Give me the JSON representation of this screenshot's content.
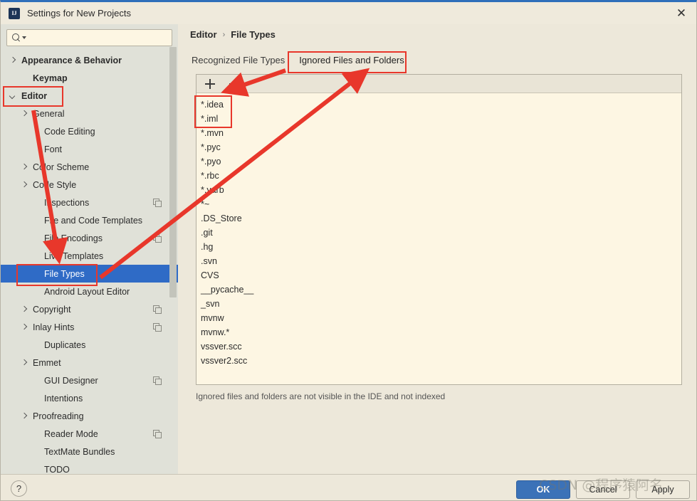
{
  "window": {
    "title": "Settings for New Projects",
    "app_icon": "intellij-idea-icon",
    "close_icon": "✕"
  },
  "sidebar": {
    "search": {
      "placeholder": "",
      "value": "",
      "icon": "search-icon"
    },
    "items": [
      {
        "label": "Appearance & Behavior",
        "indent": 0,
        "chevron": "right",
        "bold": true,
        "selected": false,
        "copy": false
      },
      {
        "label": "Keymap",
        "indent": 1,
        "chevron": "none",
        "bold": true,
        "selected": false,
        "copy": false
      },
      {
        "label": "Editor",
        "indent": 0,
        "chevron": "down",
        "bold": true,
        "selected": false,
        "copy": false
      },
      {
        "label": "General",
        "indent": 1,
        "chevron": "right",
        "bold": false,
        "selected": false,
        "copy": false
      },
      {
        "label": "Code Editing",
        "indent": 2,
        "chevron": "none",
        "bold": false,
        "selected": false,
        "copy": false
      },
      {
        "label": "Font",
        "indent": 2,
        "chevron": "none",
        "bold": false,
        "selected": false,
        "copy": false
      },
      {
        "label": "Color Scheme",
        "indent": 1,
        "chevron": "right",
        "bold": false,
        "selected": false,
        "copy": false
      },
      {
        "label": "Code Style",
        "indent": 1,
        "chevron": "right",
        "bold": false,
        "selected": false,
        "copy": false
      },
      {
        "label": "Inspections",
        "indent": 2,
        "chevron": "none",
        "bold": false,
        "selected": false,
        "copy": true
      },
      {
        "label": "File and Code Templates",
        "indent": 2,
        "chevron": "none",
        "bold": false,
        "selected": false,
        "copy": false
      },
      {
        "label": "File Encodings",
        "indent": 2,
        "chevron": "none",
        "bold": false,
        "selected": false,
        "copy": true
      },
      {
        "label": "Live Templates",
        "indent": 2,
        "chevron": "none",
        "bold": false,
        "selected": false,
        "copy": false
      },
      {
        "label": "File Types",
        "indent": 2,
        "chevron": "none",
        "bold": false,
        "selected": true,
        "copy": false
      },
      {
        "label": "Android Layout Editor",
        "indent": 2,
        "chevron": "none",
        "bold": false,
        "selected": false,
        "copy": false
      },
      {
        "label": "Copyright",
        "indent": 1,
        "chevron": "right",
        "bold": false,
        "selected": false,
        "copy": true
      },
      {
        "label": "Inlay Hints",
        "indent": 1,
        "chevron": "right",
        "bold": false,
        "selected": false,
        "copy": true
      },
      {
        "label": "Duplicates",
        "indent": 2,
        "chevron": "none",
        "bold": false,
        "selected": false,
        "copy": false
      },
      {
        "label": "Emmet",
        "indent": 1,
        "chevron": "right",
        "bold": false,
        "selected": false,
        "copy": false
      },
      {
        "label": "GUI Designer",
        "indent": 2,
        "chevron": "none",
        "bold": false,
        "selected": false,
        "copy": true
      },
      {
        "label": "Intentions",
        "indent": 2,
        "chevron": "none",
        "bold": false,
        "selected": false,
        "copy": false
      },
      {
        "label": "Proofreading",
        "indent": 1,
        "chevron": "right",
        "bold": false,
        "selected": false,
        "copy": false
      },
      {
        "label": "Reader Mode",
        "indent": 2,
        "chevron": "none",
        "bold": false,
        "selected": false,
        "copy": true
      },
      {
        "label": "TextMate Bundles",
        "indent": 2,
        "chevron": "none",
        "bold": false,
        "selected": false,
        "copy": false
      },
      {
        "label": "TODO",
        "indent": 2,
        "chevron": "none",
        "bold": false,
        "selected": false,
        "copy": false
      }
    ]
  },
  "main": {
    "breadcrumb": {
      "root": "Editor",
      "separator": "›",
      "leaf": "File Types"
    },
    "tabs": [
      {
        "label": "Recognized File Types",
        "active": false
      },
      {
        "label": "Ignored Files and Folders",
        "active": true
      }
    ],
    "toolbar": {
      "add_icon": "plus-icon",
      "remove_icon": "minus-icon"
    },
    "ignored_items": [
      "*.idea",
      "*.iml",
      "*.mvn",
      "*.pyc",
      "*.pyo",
      "*.rbc",
      "*.yarb",
      "*~",
      ".DS_Store",
      ".git",
      ".hg",
      ".svn",
      "CVS",
      "__pycache__",
      "_svn",
      "mvnw",
      "mvnw.*",
      "vssver.scc",
      "vssver2.scc"
    ],
    "hint": "Ignored files and folders are not visible in the IDE and not indexed"
  },
  "footer": {
    "help_label": "?",
    "ok_label": "OK",
    "cancel_label": "Cancel",
    "apply_label": "Apply"
  },
  "watermark": {
    "text": "CSDN @程序猿阿名"
  },
  "colors": {
    "accent_blue": "#3b72b8",
    "selection_blue": "#2f6bc6",
    "annotation_red": "#e8372b",
    "sidebar_bg": "#E0E1D8",
    "list_bg": "#FDF6E3",
    "window_bg": "#EDE8DA"
  }
}
